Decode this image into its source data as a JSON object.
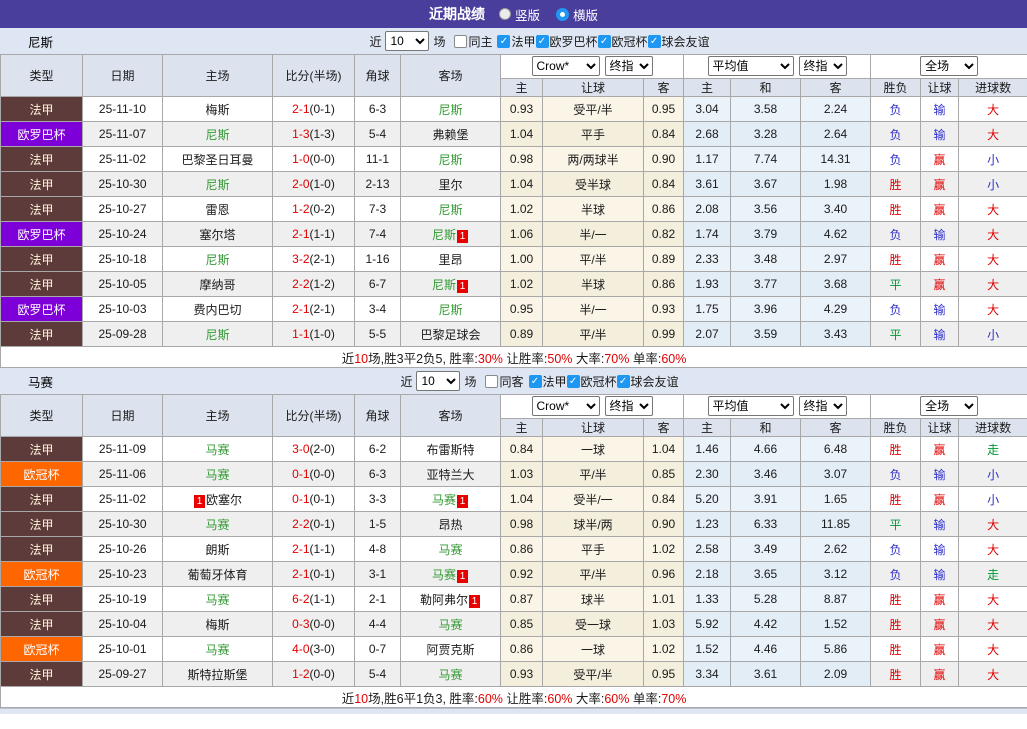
{
  "titlebar": {
    "title": "近期战绩",
    "radios": [
      {
        "label": "竖版",
        "selected": false
      },
      {
        "label": "横版",
        "selected": true
      }
    ]
  },
  "filter_labels": {
    "near": "近",
    "games": "场"
  },
  "dropdowns": {
    "crow": "Crow*",
    "final1": "终指",
    "avg": "平均值",
    "final2": "终指",
    "scope": "全场"
  },
  "table_headers": {
    "type": "类型",
    "date": "日期",
    "home": "主场",
    "score": "比分(半场)",
    "corner": "角球",
    "away": "客场",
    "h": "主",
    "handicap": "让球",
    "a": "客",
    "avg_h": "主",
    "avg_d": "和",
    "avg_a": "客",
    "result": "胜负",
    "handicap_result": "让球",
    "goals": "进球数"
  },
  "type_styles": {
    "法甲": {
      "bg": "#5e3b3b",
      "fg": "#fdf3d7"
    },
    "欧罗巴杯": {
      "bg": "#7e00d8",
      "fg": "#ffffff"
    },
    "欧冠杯": {
      "bg": "#ff6600",
      "fg": "#ffffff"
    }
  },
  "colors": {
    "titlebar_purple": "#4a3e9d",
    "accent_blue": "#1e97f3",
    "red": "#e00000",
    "blue": "#2e2ec8",
    "green": "#009933",
    "team_green": "#339933",
    "badge_red": "#e80000"
  },
  "sections": [
    {
      "team": "尼斯",
      "filter": {
        "count": "10",
        "same": {
          "label": "同主",
          "checked": false
        },
        "leagues": [
          {
            "label": "法甲",
            "checked": true
          },
          {
            "label": "欧罗巴杯",
            "checked": true
          },
          {
            "label": "欧冠杯",
            "checked": true
          },
          {
            "label": "球会友谊",
            "checked": true
          }
        ]
      },
      "rows": [
        {
          "type": "法甲",
          "date": "25-11-10",
          "home": "梅斯",
          "home_self": false,
          "home_badge": "",
          "home_badge_before": false,
          "score": "2-1",
          "half": "(0-1)",
          "corner": "6-3",
          "away": "尼斯",
          "away_self": true,
          "away_badge": "",
          "odds": [
            "0.93",
            "受平/半",
            "0.95"
          ],
          "avg": [
            "3.04",
            "3.58",
            "2.24"
          ],
          "result": "负",
          "handicap_result": "输",
          "goals": "大"
        },
        {
          "type": "欧罗巴杯",
          "date": "25-11-07",
          "home": "尼斯",
          "home_self": true,
          "home_badge": "",
          "home_badge_before": false,
          "score": "1-3",
          "half": "(1-3)",
          "corner": "5-4",
          "away": "弗赖堡",
          "away_self": false,
          "away_badge": "",
          "odds": [
            "1.04",
            "平手",
            "0.84"
          ],
          "avg": [
            "2.68",
            "3.28",
            "2.64"
          ],
          "result": "负",
          "handicap_result": "输",
          "goals": "大"
        },
        {
          "type": "法甲",
          "date": "25-11-02",
          "home": "巴黎圣日耳曼",
          "home_self": false,
          "home_badge": "",
          "home_badge_before": false,
          "score": "1-0",
          "half": "(0-0)",
          "corner": "11-1",
          "away": "尼斯",
          "away_self": true,
          "away_badge": "",
          "odds": [
            "0.98",
            "两/两球半",
            "0.90"
          ],
          "avg": [
            "1.17",
            "7.74",
            "14.31"
          ],
          "result": "负",
          "handicap_result": "赢",
          "goals": "小"
        },
        {
          "type": "法甲",
          "date": "25-10-30",
          "home": "尼斯",
          "home_self": true,
          "home_badge": "",
          "home_badge_before": false,
          "score": "2-0",
          "half": "(1-0)",
          "corner": "2-13",
          "away": "里尔",
          "away_self": false,
          "away_badge": "",
          "odds": [
            "1.04",
            "受半球",
            "0.84"
          ],
          "avg": [
            "3.61",
            "3.67",
            "1.98"
          ],
          "result": "胜",
          "handicap_result": "赢",
          "goals": "小"
        },
        {
          "type": "法甲",
          "date": "25-10-27",
          "home": "雷恩",
          "home_self": false,
          "home_badge": "",
          "home_badge_before": false,
          "score": "1-2",
          "half": "(0-2)",
          "corner": "7-3",
          "away": "尼斯",
          "away_self": true,
          "away_badge": "",
          "odds": [
            "1.02",
            "半球",
            "0.86"
          ],
          "avg": [
            "2.08",
            "3.56",
            "3.40"
          ],
          "result": "胜",
          "handicap_result": "赢",
          "goals": "大"
        },
        {
          "type": "欧罗巴杯",
          "date": "25-10-24",
          "home": "塞尔塔",
          "home_self": false,
          "home_badge": "",
          "home_badge_before": false,
          "score": "2-1",
          "half": "(1-1)",
          "corner": "7-4",
          "away": "尼斯",
          "away_self": true,
          "away_badge": "1",
          "odds": [
            "1.06",
            "半/一",
            "0.82"
          ],
          "avg": [
            "1.74",
            "3.79",
            "4.62"
          ],
          "result": "负",
          "handicap_result": "输",
          "goals": "大"
        },
        {
          "type": "法甲",
          "date": "25-10-18",
          "home": "尼斯",
          "home_self": true,
          "home_badge": "",
          "home_badge_before": false,
          "score": "3-2",
          "half": "(2-1)",
          "corner": "1-16",
          "away": "里昂",
          "away_self": false,
          "away_badge": "",
          "odds": [
            "1.00",
            "平/半",
            "0.89"
          ],
          "avg": [
            "2.33",
            "3.48",
            "2.97"
          ],
          "result": "胜",
          "handicap_result": "赢",
          "goals": "大"
        },
        {
          "type": "法甲",
          "date": "25-10-05",
          "home": "摩纳哥",
          "home_self": false,
          "home_badge": "",
          "home_badge_before": false,
          "score": "2-2",
          "half": "(1-2)",
          "corner": "6-7",
          "away": "尼斯",
          "away_self": true,
          "away_badge": "1",
          "odds": [
            "1.02",
            "半球",
            "0.86"
          ],
          "avg": [
            "1.93",
            "3.77",
            "3.68"
          ],
          "result": "平",
          "handicap_result": "赢",
          "goals": "大"
        },
        {
          "type": "欧罗巴杯",
          "date": "25-10-03",
          "home": "费内巴切",
          "home_self": false,
          "home_badge": "",
          "home_badge_before": false,
          "score": "2-1",
          "half": "(2-1)",
          "corner": "3-4",
          "away": "尼斯",
          "away_self": true,
          "away_badge": "",
          "odds": [
            "0.95",
            "半/一",
            "0.93"
          ],
          "avg": [
            "1.75",
            "3.96",
            "4.29"
          ],
          "result": "负",
          "handicap_result": "输",
          "goals": "大"
        },
        {
          "type": "法甲",
          "date": "25-09-28",
          "home": "尼斯",
          "home_self": true,
          "home_badge": "",
          "home_badge_before": false,
          "score": "1-1",
          "half": "(1-0)",
          "corner": "5-5",
          "away": "巴黎足球会",
          "away_self": false,
          "away_badge": "",
          "odds": [
            "0.89",
            "平/半",
            "0.99"
          ],
          "avg": [
            "2.07",
            "3.59",
            "3.43"
          ],
          "result": "平",
          "handicap_result": "输",
          "goals": "小"
        }
      ],
      "summary": [
        {
          "text": "近",
          "red": false
        },
        {
          "text": "10",
          "red": true
        },
        {
          "text": "场,胜3平2负5, 胜率:",
          "red": false
        },
        {
          "text": "30%",
          "red": true
        },
        {
          "text": " 让胜率:",
          "red": false
        },
        {
          "text": "50%",
          "red": true
        },
        {
          "text": " 大率:",
          "red": false
        },
        {
          "text": "70%",
          "red": true
        },
        {
          "text": " 单率:",
          "red": false
        },
        {
          "text": "60%",
          "red": true
        }
      ]
    },
    {
      "team": "马赛",
      "filter": {
        "count": "10",
        "same": {
          "label": "同客",
          "checked": false
        },
        "leagues": [
          {
            "label": "法甲",
            "checked": true
          },
          {
            "label": "欧冠杯",
            "checked": true
          },
          {
            "label": "球会友谊",
            "checked": true
          }
        ]
      },
      "rows": [
        {
          "type": "法甲",
          "date": "25-11-09",
          "home": "马赛",
          "home_self": true,
          "home_badge": "",
          "home_badge_before": false,
          "score": "3-0",
          "half": "(2-0)",
          "corner": "6-2",
          "away": "布雷斯特",
          "away_self": false,
          "away_badge": "",
          "odds": [
            "0.84",
            "一球",
            "1.04"
          ],
          "avg": [
            "1.46",
            "4.66",
            "6.48"
          ],
          "result": "胜",
          "handicap_result": "赢",
          "goals": "走"
        },
        {
          "type": "欧冠杯",
          "date": "25-11-06",
          "home": "马赛",
          "home_self": true,
          "home_badge": "",
          "home_badge_before": false,
          "score": "0-1",
          "half": "(0-0)",
          "corner": "6-3",
          "away": "亚特兰大",
          "away_self": false,
          "away_badge": "",
          "odds": [
            "1.03",
            "平/半",
            "0.85"
          ],
          "avg": [
            "2.30",
            "3.46",
            "3.07"
          ],
          "result": "负",
          "handicap_result": "输",
          "goals": "小"
        },
        {
          "type": "法甲",
          "date": "25-11-02",
          "home": "欧塞尔",
          "home_self": false,
          "home_badge": "1",
          "home_badge_before": true,
          "score": "0-1",
          "half": "(0-1)",
          "corner": "3-3",
          "away": "马赛",
          "away_self": true,
          "away_badge": "1",
          "odds": [
            "1.04",
            "受半/一",
            "0.84"
          ],
          "avg": [
            "5.20",
            "3.91",
            "1.65"
          ],
          "result": "胜",
          "handicap_result": "赢",
          "goals": "小"
        },
        {
          "type": "法甲",
          "date": "25-10-30",
          "home": "马赛",
          "home_self": true,
          "home_badge": "",
          "home_badge_before": false,
          "score": "2-2",
          "half": "(0-1)",
          "corner": "1-5",
          "away": "昂热",
          "away_self": false,
          "away_badge": "",
          "odds": [
            "0.98",
            "球半/两",
            "0.90"
          ],
          "avg": [
            "1.23",
            "6.33",
            "11.85"
          ],
          "result": "平",
          "handicap_result": "输",
          "goals": "大"
        },
        {
          "type": "法甲",
          "date": "25-10-26",
          "home": "朗斯",
          "home_self": false,
          "home_badge": "",
          "home_badge_before": false,
          "score": "2-1",
          "half": "(1-1)",
          "corner": "4-8",
          "away": "马赛",
          "away_self": true,
          "away_badge": "",
          "odds": [
            "0.86",
            "平手",
            "1.02"
          ],
          "avg": [
            "2.58",
            "3.49",
            "2.62"
          ],
          "result": "负",
          "handicap_result": "输",
          "goals": "大"
        },
        {
          "type": "欧冠杯",
          "date": "25-10-23",
          "home": "葡萄牙体育",
          "home_self": false,
          "home_badge": "",
          "home_badge_before": false,
          "score": "2-1",
          "half": "(0-1)",
          "corner": "3-1",
          "away": "马赛",
          "away_self": true,
          "away_badge": "1",
          "odds": [
            "0.92",
            "平/半",
            "0.96"
          ],
          "avg": [
            "2.18",
            "3.65",
            "3.12"
          ],
          "result": "负",
          "handicap_result": "输",
          "goals": "走"
        },
        {
          "type": "法甲",
          "date": "25-10-19",
          "home": "马赛",
          "home_self": true,
          "home_badge": "",
          "home_badge_before": false,
          "score": "6-2",
          "half": "(1-1)",
          "corner": "2-1",
          "away": "勒阿弗尔",
          "away_self": false,
          "away_badge": "1",
          "odds": [
            "0.87",
            "球半",
            "1.01"
          ],
          "avg": [
            "1.33",
            "5.28",
            "8.87"
          ],
          "result": "胜",
          "handicap_result": "赢",
          "goals": "大"
        },
        {
          "type": "法甲",
          "date": "25-10-04",
          "home": "梅斯",
          "home_self": false,
          "home_badge": "",
          "home_badge_before": false,
          "score": "0-3",
          "half": "(0-0)",
          "corner": "4-4",
          "away": "马赛",
          "away_self": true,
          "away_badge": "",
          "odds": [
            "0.85",
            "受一球",
            "1.03"
          ],
          "avg": [
            "5.92",
            "4.42",
            "1.52"
          ],
          "result": "胜",
          "handicap_result": "赢",
          "goals": "大"
        },
        {
          "type": "欧冠杯",
          "date": "25-10-01",
          "home": "马赛",
          "home_self": true,
          "home_badge": "",
          "home_badge_before": false,
          "score": "4-0",
          "half": "(3-0)",
          "corner": "0-7",
          "away": "阿贾克斯",
          "away_self": false,
          "away_badge": "",
          "odds": [
            "0.86",
            "一球",
            "1.02"
          ],
          "avg": [
            "1.52",
            "4.46",
            "5.86"
          ],
          "result": "胜",
          "handicap_result": "赢",
          "goals": "大"
        },
        {
          "type": "法甲",
          "date": "25-09-27",
          "home": "斯特拉斯堡",
          "home_self": false,
          "home_badge": "",
          "home_badge_before": false,
          "score": "1-2",
          "half": "(0-0)",
          "corner": "5-4",
          "away": "马赛",
          "away_self": true,
          "away_badge": "",
          "odds": [
            "0.93",
            "受平/半",
            "0.95"
          ],
          "avg": [
            "3.34",
            "3.61",
            "2.09"
          ],
          "result": "胜",
          "handicap_result": "赢",
          "goals": "大"
        }
      ],
      "summary": [
        {
          "text": "近",
          "red": false
        },
        {
          "text": "10",
          "red": true
        },
        {
          "text": "场,胜6平1负3, 胜率:",
          "red": false
        },
        {
          "text": "60%",
          "red": true
        },
        {
          "text": " 让胜率:",
          "red": false
        },
        {
          "text": "60%",
          "red": true
        },
        {
          "text": " 大率:",
          "red": false
        },
        {
          "text": "60%",
          "red": true
        },
        {
          "text": " 单率:",
          "red": false
        },
        {
          "text": "70%",
          "red": true
        }
      ]
    }
  ]
}
